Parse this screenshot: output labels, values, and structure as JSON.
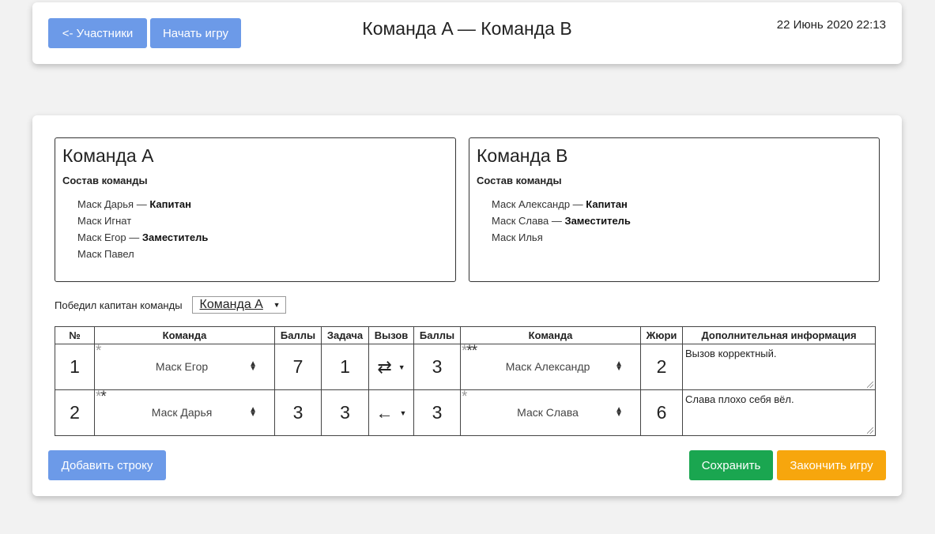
{
  "header": {
    "back_label": "<- Участники",
    "start_label": "Начать игру",
    "title": "Команда A — Команда B",
    "datetime": "22 Июнь 2020 22:13"
  },
  "team_a": {
    "name": "Команда A",
    "roster_heading": "Состав команды",
    "members": [
      {
        "name": "Маск Дарья",
        "sep": " — ",
        "role": "Капитан"
      },
      {
        "name": "Маск Игнат",
        "sep": "",
        "role": ""
      },
      {
        "name": "Маск Егор",
        "sep": " — ",
        "role": "Заместитель"
      },
      {
        "name": "Маск Павел",
        "sep": "",
        "role": ""
      }
    ]
  },
  "team_b": {
    "name": "Команда B",
    "roster_heading": "Состав команды",
    "members": [
      {
        "name": "Маск Александр",
        "sep": " — ",
        "role": "Капитан"
      },
      {
        "name": "Маск Слава",
        "sep": " — ",
        "role": "Заместитель"
      },
      {
        "name": "Маск Илья",
        "sep": "",
        "role": ""
      }
    ]
  },
  "captain": {
    "label": "Победил капитан команды",
    "selected": "Команда A"
  },
  "table": {
    "headers": [
      "№",
      "Команда",
      "Баллы",
      "Задача",
      "Вызов",
      "Баллы",
      "Команда",
      "Жюри",
      "Дополнительная информация"
    ],
    "rows": [
      {
        "num": "1",
        "left_stars_light": "*",
        "left_stars_dark": "",
        "left_player": "Маск Егор",
        "left_score": "7",
        "task": "1",
        "call": "⇄",
        "right_score": "3",
        "right_stars_light": "*",
        "right_stars_dark": "**",
        "right_player": "Маск Александр",
        "jury": "2",
        "info": "Вызов корректный."
      },
      {
        "num": "2",
        "left_stars_light": "*",
        "left_stars_dark": "*",
        "left_player": "Маск Дарья",
        "left_score": "3",
        "task": "3",
        "call": "←",
        "right_score": "3",
        "right_stars_light": "*",
        "right_stars_dark": "",
        "right_player": "Маск Слава",
        "jury": "6",
        "info": "Слава плохо себя вёл."
      }
    ]
  },
  "footer": {
    "add_row_label": "Добавить строку",
    "save_label": "Сохранить",
    "finish_label": "Закончить игру"
  },
  "colors": {
    "primary": "#6c9ae8",
    "success": "#1aa650",
    "warning": "#f7a60d"
  },
  "icons": {
    "select_arrows": "updown-arrows-icon",
    "dropdown_caret": "caret-down-icon",
    "resize_grip": "resize-grip-icon"
  }
}
